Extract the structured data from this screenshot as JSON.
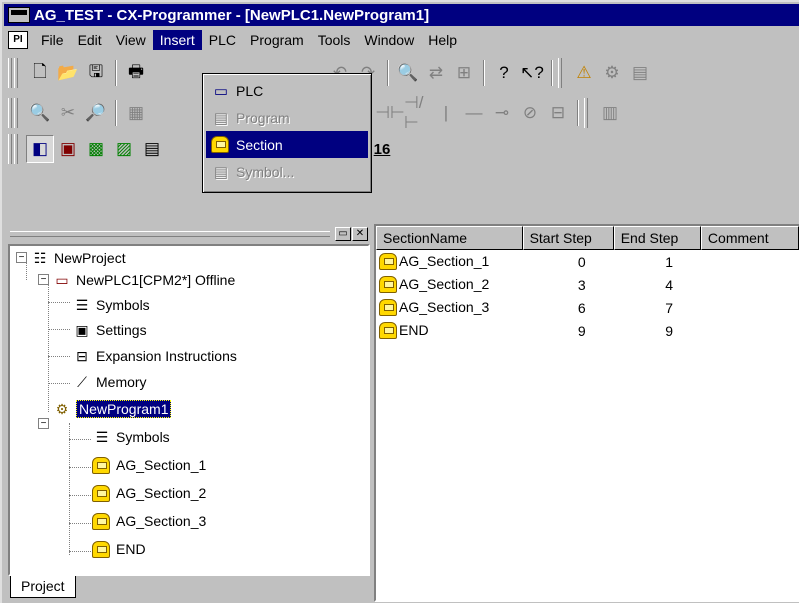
{
  "window": {
    "title": "AG_TEST - CX-Programmer - [NewPLC1.NewProgram1]"
  },
  "menubar": {
    "items": [
      {
        "label": "File"
      },
      {
        "label": "Edit"
      },
      {
        "label": "View"
      },
      {
        "label": "Insert"
      },
      {
        "label": "PLC"
      },
      {
        "label": "Program"
      },
      {
        "label": "Tools"
      },
      {
        "label": "Window"
      },
      {
        "label": "Help"
      }
    ],
    "active": "Insert"
  },
  "insert_menu": {
    "items": [
      {
        "label": "PLC",
        "icon": "plc-icon",
        "state": "enabled"
      },
      {
        "label": "Program",
        "icon": "program-icon",
        "state": "disabled"
      },
      {
        "label": "Section",
        "icon": "section-icon",
        "state": "selected"
      },
      {
        "label": "Symbol...",
        "icon": "symbol-icon",
        "state": "disabled"
      }
    ]
  },
  "toolbar3": {
    "zoom_label": "16"
  },
  "project_tree": {
    "tab_label": "Project",
    "nodes": [
      {
        "label": "NewProject",
        "icon": "project-icon"
      },
      {
        "label": "NewPLC1[CPM2*] Offline",
        "icon": "plc-icon"
      },
      {
        "label": "Symbols",
        "icon": "symbols-icon"
      },
      {
        "label": "Settings",
        "icon": "settings-icon"
      },
      {
        "label": "Expansion Instructions",
        "icon": "expansion-icon"
      },
      {
        "label": "Memory",
        "icon": "memory-icon"
      },
      {
        "label": "NewProgram1",
        "icon": "program-icon"
      },
      {
        "label": "Symbols",
        "icon": "symbols-icon"
      },
      {
        "label": "AG_Section_1",
        "icon": "section-icon"
      },
      {
        "label": "AG_Section_2",
        "icon": "section-icon"
      },
      {
        "label": "AG_Section_3",
        "icon": "section-icon"
      },
      {
        "label": "END",
        "icon": "section-icon"
      }
    ]
  },
  "section_list": {
    "columns": [
      "SectionName",
      "Start Step",
      "End Step",
      "Comment"
    ],
    "rows": [
      {
        "name": "AG_Section_1",
        "start": "0",
        "end": "1",
        "comment": ""
      },
      {
        "name": "AG_Section_2",
        "start": "3",
        "end": "4",
        "comment": ""
      },
      {
        "name": "AG_Section_3",
        "start": "6",
        "end": "7",
        "comment": ""
      },
      {
        "name": "END",
        "start": "9",
        "end": "9",
        "comment": ""
      }
    ]
  },
  "colors": {
    "title_bar": "#000080",
    "selection": "#000080",
    "face": "#c0c0c0"
  }
}
